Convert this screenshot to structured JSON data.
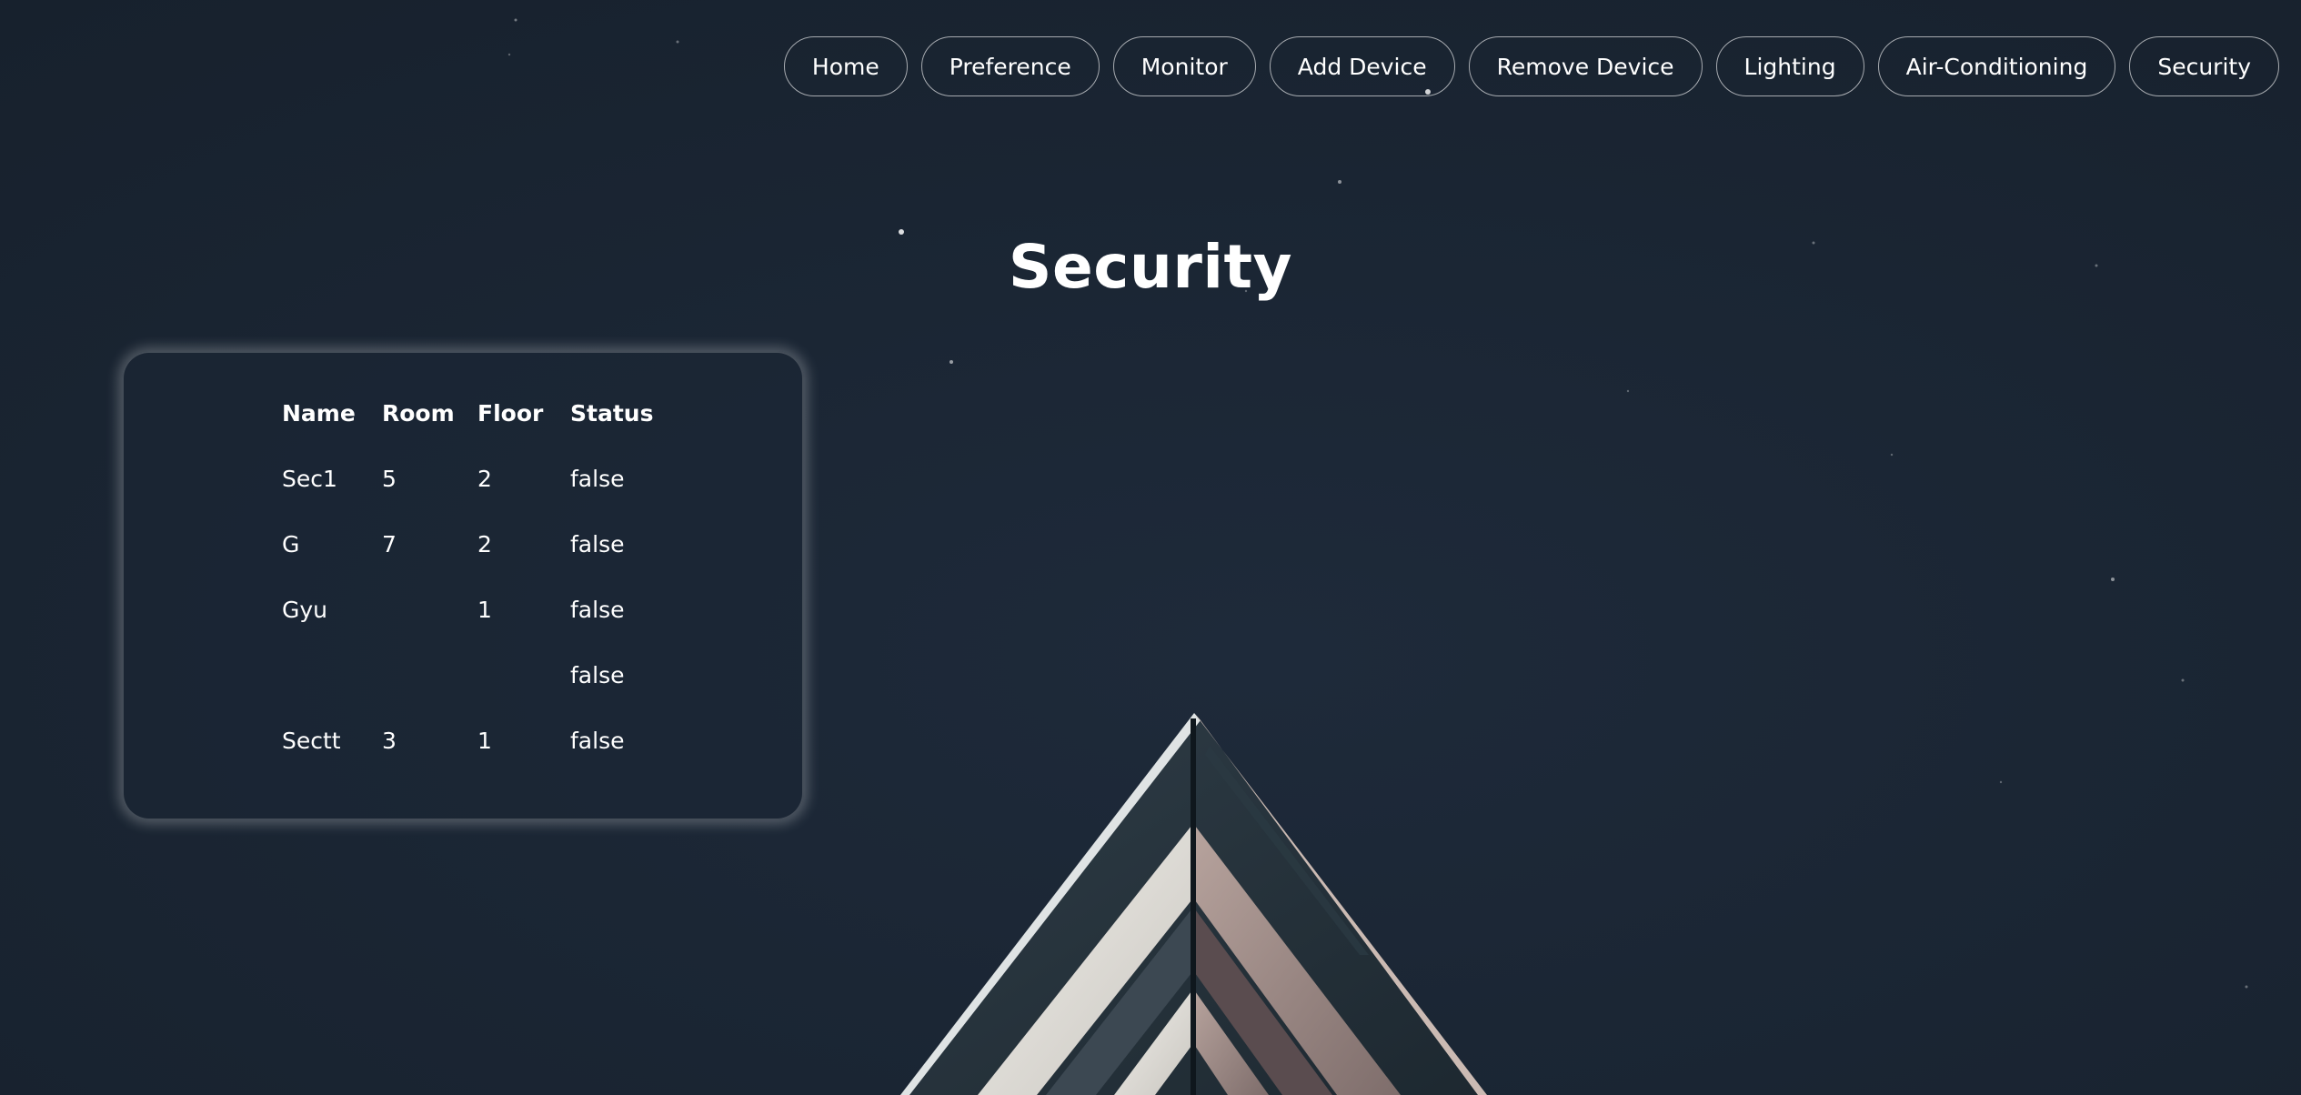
{
  "nav": {
    "items": [
      {
        "label": "Home",
        "name": "nav-home-button"
      },
      {
        "label": "Preference",
        "name": "nav-preference-button"
      },
      {
        "label": "Monitor",
        "name": "nav-monitor-button"
      },
      {
        "label": "Add Device",
        "name": "nav-add-device-button"
      },
      {
        "label": "Remove Device",
        "name": "nav-remove-device-button"
      },
      {
        "label": "Lighting",
        "name": "nav-lighting-button"
      },
      {
        "label": "Air-Conditioning",
        "name": "nav-air-conditioning-button"
      },
      {
        "label": "Security",
        "name": "nav-security-button"
      }
    ]
  },
  "page": {
    "title": "Security"
  },
  "table": {
    "headers": [
      "Name",
      "Room",
      "Floor",
      "Status"
    ],
    "rows": [
      [
        "Sec1",
        "5",
        "2",
        "false"
      ],
      [
        "G",
        "7",
        "2",
        "false"
      ],
      [
        "Gyu",
        "",
        "1",
        "false"
      ],
      [
        "",
        "",
        "",
        "false"
      ],
      [
        "Sectt",
        "3",
        "1",
        "false"
      ]
    ]
  },
  "theme": {
    "background": "#1b2634",
    "text": "#ffffff",
    "border": "rgba(255,255,255,0.62)"
  }
}
